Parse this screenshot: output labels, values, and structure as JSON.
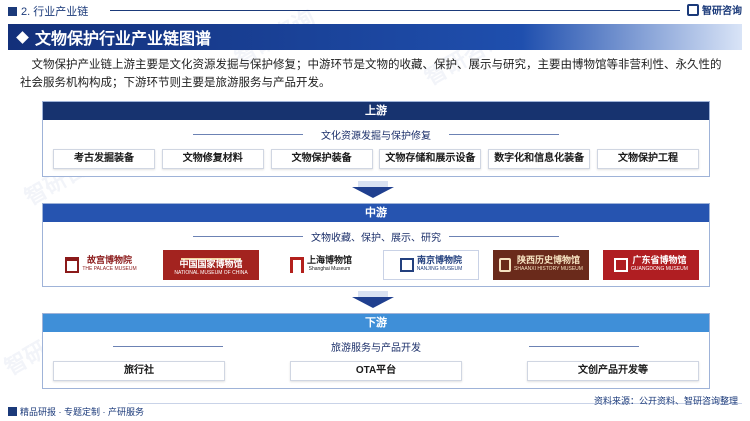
{
  "header": {
    "section_label": "2. 行业产业链",
    "brand": "智研咨询"
  },
  "banner": {
    "title": "文物保护行业产业链图谱"
  },
  "intro": "文物保护产业链上游主要是文化资源发掘与保护修复；中游环节是文物的收藏、保护、展示与研究，主要由博物馆等非营利性、永久性的社会服务机构构成；下游环节则主要是旅游服务与产品开发。",
  "upstream": {
    "heading": "上游",
    "subtitle": "文化资源发掘与保护修复",
    "items": [
      "考古发掘装备",
      "文物修复材料",
      "文物保护装备",
      "文物存储和展示设备",
      "数字化和信息化装备",
      "文物保护工程"
    ]
  },
  "midstream": {
    "heading": "中游",
    "subtitle": "文物收藏、保护、展示、研究",
    "museums": [
      {
        "cn": "故宫博物院",
        "en": "THE PALACE MUSEUM"
      },
      {
        "cn": "中国国家博物馆",
        "en": "NATIONAL MUSEUM OF CHINA"
      },
      {
        "cn": "上海博物馆",
        "en": "Shanghai Museum"
      },
      {
        "cn": "南京博物院",
        "en": "NANJING MUSEUM"
      },
      {
        "cn": "陕西历史博物馆",
        "en": "SHAANXI HISTORY MUSEUM"
      },
      {
        "cn": "广东省博物馆",
        "en": "GUANGDONG MUSEUM"
      }
    ]
  },
  "downstream": {
    "heading": "下游",
    "subtitle": "旅游服务与产品开发",
    "items": [
      "旅行社",
      "OTA平台",
      "文创产品开发等"
    ]
  },
  "footer": {
    "left": "精品研报 · 专题定制 · 产研服务",
    "source": "资料来源：公开资料、智研咨询整理"
  },
  "watermark": "智研咨询"
}
